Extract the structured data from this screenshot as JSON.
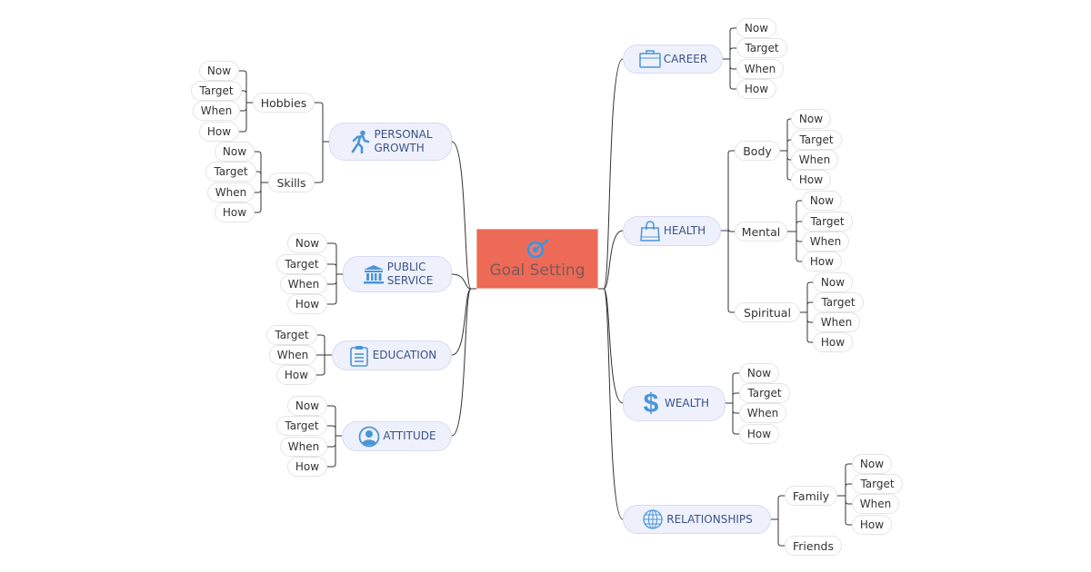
{
  "central": {
    "label": "Goal Setting",
    "icon": "target-icon",
    "color": "#ec6a56"
  },
  "colors": {
    "main_fill": "#eef1fc",
    "main_text": "#3a5288",
    "icon_blue": "#4a95d6",
    "line": "#333333"
  },
  "right_branches": [
    {
      "label": "CAREER",
      "icon": "briefcase-icon",
      "children": [
        {
          "label": "Now"
        },
        {
          "label": "Target"
        },
        {
          "label": "When"
        },
        {
          "label": "How"
        }
      ]
    },
    {
      "label": "HEALTH",
      "icon": "shopping-bag-icon",
      "children": [
        {
          "label": "Body",
          "children": [
            {
              "label": "Now"
            },
            {
              "label": "Target"
            },
            {
              "label": "When"
            },
            {
              "label": "How"
            }
          ]
        },
        {
          "label": "Mental",
          "children": [
            {
              "label": "Now"
            },
            {
              "label": "Target"
            },
            {
              "label": "When"
            },
            {
              "label": "How"
            }
          ]
        },
        {
          "label": "Spiritual",
          "children": [
            {
              "label": "Now"
            },
            {
              "label": "Target"
            },
            {
              "label": "When"
            },
            {
              "label": "How"
            }
          ]
        }
      ]
    },
    {
      "label": "WEALTH",
      "icon": "dollar-icon",
      "children": [
        {
          "label": "Now"
        },
        {
          "label": "Target"
        },
        {
          "label": "When"
        },
        {
          "label": "How"
        }
      ]
    },
    {
      "label": "RELATIONSHIPS",
      "icon": "globe-icon",
      "children": [
        {
          "label": "Family",
          "children": [
            {
              "label": "Now"
            },
            {
              "label": "Target"
            },
            {
              "label": "When"
            },
            {
              "label": "How"
            }
          ]
        },
        {
          "label": "Friends"
        }
      ]
    }
  ],
  "left_branches": [
    {
      "label": "PERSONAL GROWTH",
      "line1": "PERSONAL",
      "line2": "GROWTH",
      "icon": "walking-person-icon",
      "children": [
        {
          "label": "Hobbies",
          "children": [
            {
              "label": "Now"
            },
            {
              "label": "Target"
            },
            {
              "label": "When"
            },
            {
              "label": "How"
            }
          ]
        },
        {
          "label": "Skills",
          "children": [
            {
              "label": "Now"
            },
            {
              "label": "Target"
            },
            {
              "label": "When"
            },
            {
              "label": "How"
            }
          ]
        }
      ]
    },
    {
      "label": "PUBLIC SERVICE",
      "line1": "PUBLIC",
      "line2": "SERVICE",
      "icon": "bank-building-icon",
      "children": [
        {
          "label": "Now"
        },
        {
          "label": "Target"
        },
        {
          "label": "When"
        },
        {
          "label": "How"
        }
      ]
    },
    {
      "label": "EDUCATION",
      "icon": "clipboard-icon",
      "children": [
        {
          "label": "Target"
        },
        {
          "label": "When"
        },
        {
          "label": "How"
        }
      ]
    },
    {
      "label": "ATTITUDE",
      "icon": "user-circle-icon",
      "children": [
        {
          "label": "Now"
        },
        {
          "label": "Target"
        },
        {
          "label": "When"
        },
        {
          "label": "How"
        }
      ]
    }
  ]
}
